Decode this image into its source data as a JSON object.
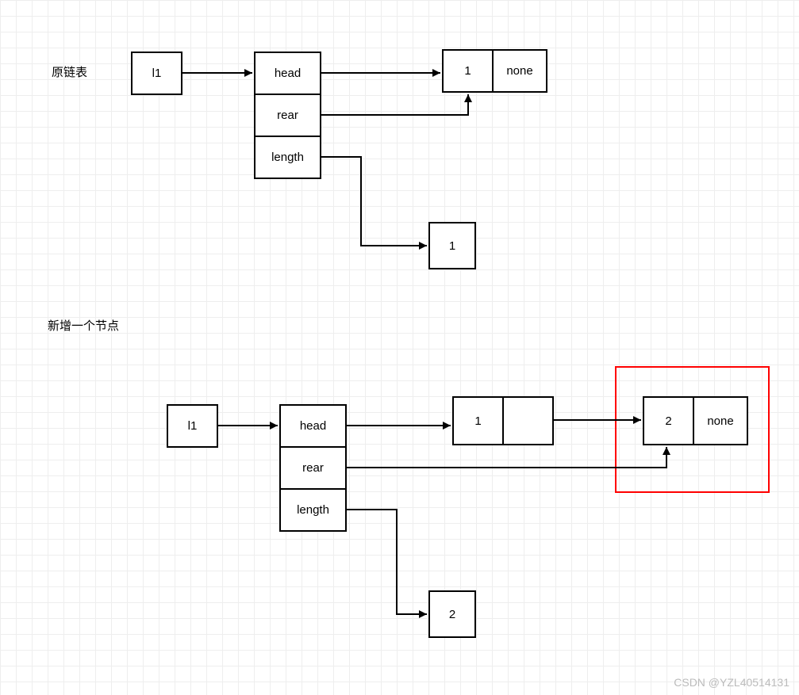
{
  "labels": {
    "section1": "原链表",
    "section2": "新增一个节点"
  },
  "diagram1": {
    "l1": "l1",
    "head": "head",
    "rear": "rear",
    "length": "length",
    "node1_val": "1",
    "node1_next": "none",
    "length_val": "1"
  },
  "diagram2": {
    "l1": "l1",
    "head": "head",
    "rear": "rear",
    "length": "length",
    "node1_val": "1",
    "node1_next": "",
    "node2_val": "2",
    "node2_next": "none",
    "length_val": "2"
  },
  "watermark": "CSDN @YZL40514131"
}
